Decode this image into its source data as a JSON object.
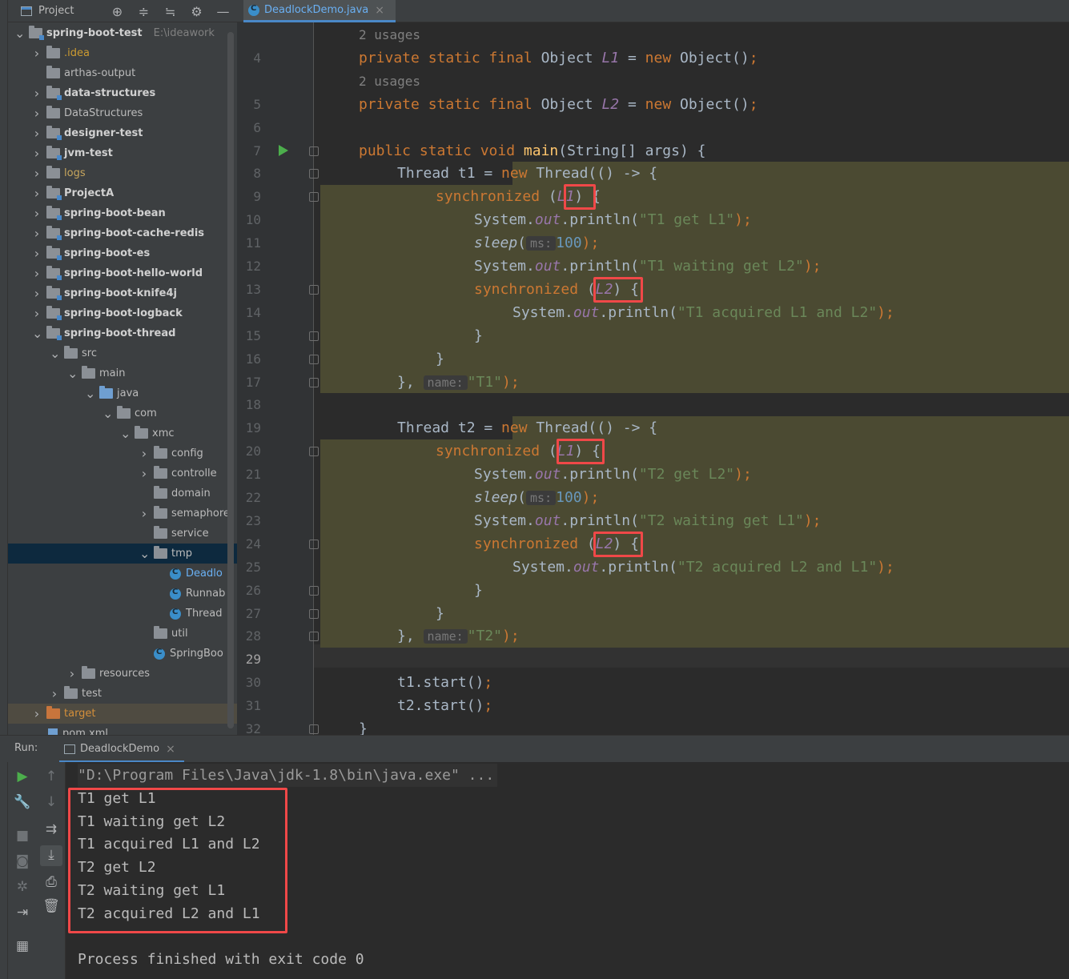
{
  "project_panel": {
    "title": "Project",
    "tools": [
      "⊕",
      "≑",
      "≒",
      "⚙",
      "—"
    ]
  },
  "editor_tab": {
    "label": "DeadlockDemo.java",
    "close": "×"
  },
  "tree": [
    {
      "label": "spring-boot-test",
      "path": "E:\\ideawork",
      "style": "bold",
      "arrow": "v"
    },
    {
      "label": ".idea",
      "style": "idea",
      "arrow": ">"
    },
    {
      "label": "arthas-output",
      "style": "",
      "arrow": ""
    },
    {
      "label": "data-structures",
      "style": "bold",
      "arrow": ">"
    },
    {
      "label": "DataStructures",
      "style": "",
      "arrow": ">"
    },
    {
      "label": "designer-test",
      "style": "bold",
      "arrow": ">"
    },
    {
      "label": "jvm-test",
      "style": "bold",
      "arrow": ">"
    },
    {
      "label": "logs",
      "style": "logs",
      "arrow": ">"
    },
    {
      "label": "ProjectA",
      "style": "bold",
      "arrow": ">"
    },
    {
      "label": "spring-boot-bean",
      "style": "bold",
      "arrow": ">"
    },
    {
      "label": "spring-boot-cache-redis",
      "style": "bold",
      "arrow": ">"
    },
    {
      "label": "spring-boot-es",
      "style": "bold",
      "arrow": ">"
    },
    {
      "label": "spring-boot-hello-world",
      "style": "bold",
      "arrow": ">"
    },
    {
      "label": "spring-boot-knife4j",
      "style": "bold",
      "arrow": ">"
    },
    {
      "label": "spring-boot-logback",
      "style": "bold",
      "arrow": ">"
    },
    {
      "label": "spring-boot-thread",
      "style": "bold",
      "arrow": "v"
    },
    {
      "label": "src",
      "style": "",
      "arrow": "v"
    },
    {
      "label": "main",
      "style": "",
      "arrow": "v"
    },
    {
      "label": "java",
      "style": "",
      "arrow": "v"
    },
    {
      "label": "com",
      "style": "",
      "arrow": "v"
    },
    {
      "label": "xmc",
      "style": "",
      "arrow": "v"
    },
    {
      "label": "config",
      "style": "",
      "arrow": ">"
    },
    {
      "label": "controlle",
      "style": "",
      "arrow": ">"
    },
    {
      "label": "domain",
      "style": "",
      "arrow": ""
    },
    {
      "label": "semaphore",
      "style": "",
      "arrow": ">"
    },
    {
      "label": "service",
      "style": "",
      "arrow": ""
    },
    {
      "label": "tmp",
      "style": "",
      "arrow": "v"
    },
    {
      "label": "Deadlo",
      "style": "blue-file",
      "arrow": ""
    },
    {
      "label": "Runnab",
      "style": "",
      "arrow": ""
    },
    {
      "label": "Thread",
      "style": "",
      "arrow": ""
    },
    {
      "label": "util",
      "style": "",
      "arrow": ""
    },
    {
      "label": "SpringBoo",
      "style": "",
      "arrow": ""
    },
    {
      "label": "resources",
      "style": "",
      "arrow": ">"
    },
    {
      "label": "test",
      "style": "",
      "arrow": ">"
    },
    {
      "label": "target",
      "style": "orange",
      "arrow": ">"
    },
    {
      "label": "pom.xml",
      "style": "",
      "arrow": ""
    }
  ],
  "code": {
    "usages": "2 usages",
    "line_numbers": [
      "4",
      "5",
      "6",
      "7",
      "8",
      "9",
      "10",
      "11",
      "12",
      "13",
      "14",
      "15",
      "16",
      "17",
      "18",
      "19",
      "20",
      "21",
      "22",
      "23",
      "24",
      "25",
      "26",
      "27",
      "28",
      "29",
      "30",
      "31",
      "32"
    ],
    "kw_private_static_final": "private static final ",
    "type_object": "Object ",
    "field_l1": "L1",
    "field_l2": "L2",
    "eq_new": " = ",
    "kw_new": "new ",
    "object_ctor": "Object()",
    "semi": ";",
    "kw_public_static_void": "public static void ",
    "main_name": "main",
    "main_params": "(String[] args) {",
    "thread_t1": "Thread t1 = ",
    "thread_t2": "Thread t2 = ",
    "thread_ctor": "Thread(() -> {",
    "kw_synchronized": "synchronized ",
    "open_paren": "(",
    "close_paren": ")",
    "brace_open": " {",
    "system": "System.",
    "out": "out",
    "println_open": ".println(",
    "t1_get": "\"T1 get L1\"",
    "t1_wait": "\"T1 waiting get L2\"",
    "t1_acq": "\"T1 acquired L1 and L2\"",
    "t2_get": "\"T2 get L2\"",
    "t2_wait": "\"T2 waiting get L1\"",
    "t2_acq": "\"T2 acquired L2 and L1\"",
    "close_semi": ");",
    "sleep": "sleep",
    "ms_hint": "ms:",
    "sleep_val": "100",
    "brace_close": "}",
    "lambda_end": "}, ",
    "name_hint": "name:",
    "t1_name": "\"T1\"",
    "t2_name": "\"T2\"",
    "t1_start": "t1.start()",
    "t2_start": "t2.start()"
  },
  "run_panel": {
    "label": "Run:",
    "tab_label": "DeadlockDemo",
    "close": "×",
    "command": "\"D:\\Program Files\\Java\\jdk-1.8\\bin\\java.exe\" ...",
    "output": [
      "T1 get L1",
      "T1 waiting get L2",
      "T1 acquired L1 and L2",
      "T2 get L2",
      "T2 waiting get L1",
      "T2 acquired L2 and L1"
    ],
    "finished": "Process finished with exit code 0"
  },
  "colors": {
    "keyword": "#cc7832",
    "string": "#6a8759",
    "number": "#6897bb",
    "field": "#9876aa",
    "method": "#ffc66d",
    "highlight_band": "#4b4a32",
    "annotation_box": "#f04848"
  }
}
